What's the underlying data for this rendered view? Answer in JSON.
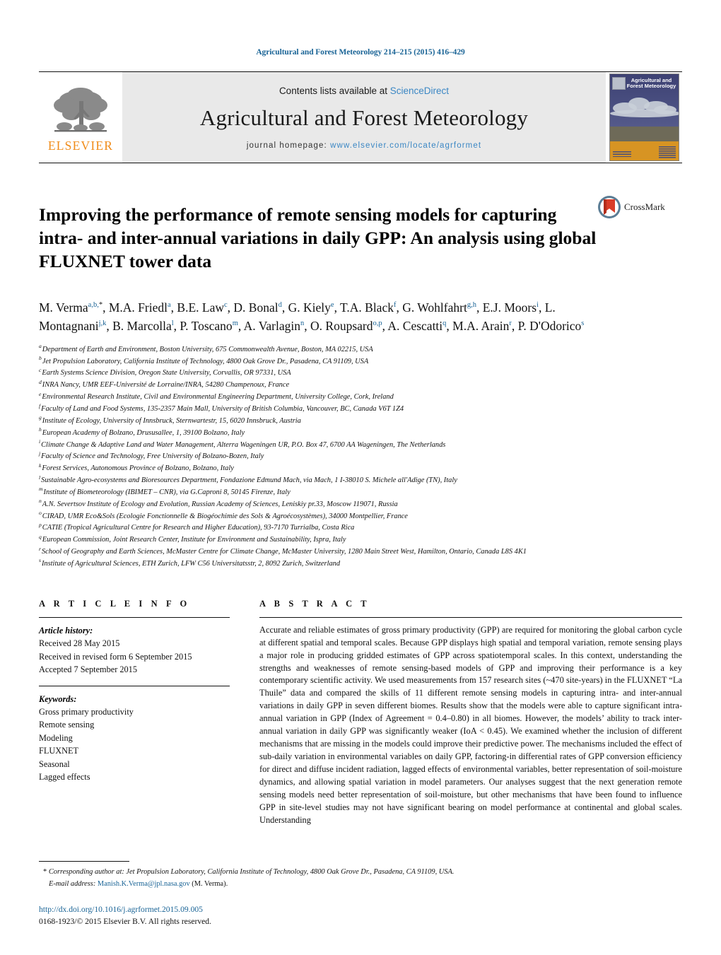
{
  "running_head": "Agricultural and Forest Meteorology 214–215 (2015) 416–429",
  "masthead": {
    "publisher_name": "ELSEVIER",
    "contents_prefix": "Contents lists available at ",
    "sciencedirect": "ScienceDirect",
    "journal_title": "Agricultural and Forest Meteorology",
    "homepage_label": "journal homepage: ",
    "homepage_url": "www.elsevier.com/locate/agrformet",
    "cover_title": "Agricultural and Forest Meteorology"
  },
  "article": {
    "title": "Improving the performance of remote sensing models for capturing intra- and inter-annual variations in daily GPP: An analysis using global FLUXNET tower data",
    "crossmark_label": "CrossMark",
    "authors_html": "M. Verma<sup class=\"sup\">a,b,</sup><sup class=\"sup star\">*</sup>, M.A. Friedl<sup class=\"sup\">a</sup>, B.E. Law<sup class=\"sup\">c</sup>, D. Bonal<sup class=\"sup\">d</sup>, G. Kiely<sup class=\"sup\">e</sup>, T.A. Black<sup class=\"sup\">f</sup>, G. Wohlfahrt<sup class=\"sup\">g,h</sup>, E.J. Moors<sup class=\"sup\">i</sup>, L. Montagnani<sup class=\"sup\">j,k</sup>, B. Marcolla<sup class=\"sup\">l</sup>, P. Toscano<sup class=\"sup\">m</sup>, A. Varlagin<sup class=\"sup\">n</sup>, O. Roupsard<sup class=\"sup\">o,p</sup>, A. Cescatti<sup class=\"sup\">q</sup>, M.A. Arain<sup class=\"sup\">r</sup>, P. D'Odorico<sup class=\"sup\">s</sup>"
  },
  "affiliations": [
    {
      "label": "a",
      "text": "Department of Earth and Environment, Boston University, 675 Commonwealth Avenue, Boston, MA 02215, USA"
    },
    {
      "label": "b",
      "text": "Jet Propulsion Laboratory, California Institute of Technology, 4800 Oak Grove Dr., Pasadena, CA 91109, USA"
    },
    {
      "label": "c",
      "text": "Earth Systems Science Division, Oregon State University, Corvallis, OR 97331, USA"
    },
    {
      "label": "d",
      "text": "INRA Nancy, UMR EEF-Université de Lorraine/INRA, 54280 Champenoux, France"
    },
    {
      "label": "e",
      "text": "Environmental Research Institute, Civil and Environmental Engineering Department, University College, Cork, Ireland"
    },
    {
      "label": "f",
      "text": "Faculty of Land and Food Systems, 135-2357 Main Mall, University of British Columbia, Vancouver, BC, Canada V6T 1Z4"
    },
    {
      "label": "g",
      "text": "Institute of Ecology, University of Innsbruck, Sternwartestr, 15, 6020 Innsbruck, Austria"
    },
    {
      "label": "h",
      "text": "European Academy of Bolzano, Drususallee, 1, 39100 Bolzano, Italy"
    },
    {
      "label": "i",
      "text": "Climate Change & Adaptive Land and Water Management, Alterra Wageningen UR, P.O. Box 47, 6700 AA Wageningen, The Netherlands"
    },
    {
      "label": "j",
      "text": "Faculty of Science and Technology, Free University of Bolzano-Bozen, Italy"
    },
    {
      "label": "k",
      "text": "Forest Services, Autonomous Province of Bolzano, Bolzano, Italy"
    },
    {
      "label": "l",
      "text": "Sustainable Agro-ecosystems and Bioresources Department, Fondazione Edmund Mach, via Mach, 1 I-38010 S. Michele all'Adige (TN), Italy"
    },
    {
      "label": "m",
      "text": "Institute of Biometeorology (IBIMET – CNR), via G.Caproni 8, 50145 Firenze, Italy"
    },
    {
      "label": "n",
      "text": "A.N. Severtsov Institute of Ecology and Evolution, Russian Academy of Sciences, Leniskiy pr.33, Moscow 119071, Russia"
    },
    {
      "label": "o",
      "text": "CIRAD, UMR Eco&Sols (Ecologie Fonctionnelle & Biogéochimie des Sols & Agroécosystèmes), 34000 Montpellier, France"
    },
    {
      "label": "p",
      "text": "CATIE (Tropical Agricultural Centre for Research and Higher Education), 93-7170 Turrialba, Costa Rica"
    },
    {
      "label": "q",
      "text": "European Commission, Joint Research Center, Institute for Environment and Sustainability, Ispra, Italy"
    },
    {
      "label": "r",
      "text": "School of Geography and Earth Sciences, McMaster Centre for Climate Change, McMaster University, 1280 Main Street West, Hamilton, Ontario, Canada L8S 4K1"
    },
    {
      "label": "s",
      "text": "Institute of Agricultural Sciences, ETH Zurich, LFW C56 Universitatsstr, 2, 8092 Zurich, Switzerland"
    }
  ],
  "article_info": {
    "heading": "A R T I C L E   I N F O",
    "history_label": "Article history:",
    "history": [
      "Received 28 May 2015",
      "Received in revised form 6 September 2015",
      "Accepted 7 September 2015"
    ],
    "keywords_label": "Keywords:",
    "keywords": [
      "Gross primary productivity",
      "Remote sensing",
      "Modeling",
      "FLUXNET",
      "Seasonal",
      "Lagged effects"
    ]
  },
  "abstract": {
    "heading": "A B S T R A C T",
    "text": "Accurate and reliable estimates of gross primary productivity (GPP) are required for monitoring the global carbon cycle at different spatial and temporal scales. Because GPP displays high spatial and temporal variation, remote sensing plays a major role in producing gridded estimates of GPP across spatiotemporal scales. In this context, understanding the strengths and weaknesses of remote sensing-based models of GPP and improving their performance is a key contemporary scientific activity. We used measurements from 157 research sites (~470 site-years) in the FLUXNET “La Thuile” data and compared the skills of 11 different remote sensing models in capturing intra- and inter-annual variations in daily GPP in seven different biomes. Results show that the models were able to capture significant intra-annual variation in GPP (Index of Agreement = 0.4–0.80) in all biomes. However, the models’ ability to track inter-annual variation in daily GPP was significantly weaker (IoA < 0.45). We examined whether the inclusion of different mechanisms that are missing in the models could improve their predictive power. The mechanisms included the effect of sub-daily variation in environmental variables on daily GPP, factoring-in differential rates of GPP conversion efficiency for direct and diffuse incident radiation, lagged effects of environmental variables, better representation of soil-moisture dynamics, and allowing spatial variation in model parameters. Our analyses suggest that the next generation remote sensing models need better representation of soil-moisture, but other mechanisms that have been found to influence GPP in site-level studies may not have significant bearing on model performance at continental and global scales. Understanding"
  },
  "footer": {
    "corresponding_star": "*",
    "corresponding_text": "Corresponding author at: Jet Propulsion Laboratory, California Institute of Technology, 4800 Oak Grove Dr., Pasadena, CA 91109, USA.",
    "email_label": "E-mail address:",
    "email": "Manish.K.Verma@jpl.nasa.gov",
    "email_suffix": "(M. Verma).",
    "doi": "http://dx.doi.org/10.1016/j.agrformet.2015.09.005",
    "copyright": "0168-1923/© 2015 Elsevier B.V. All rights reserved."
  },
  "colors": {
    "link_blue": "#1a6496",
    "sciencedirect_blue": "#3b87c4",
    "elsevier_orange": "#F08C1A",
    "masthead_gray": "#e9e9e9"
  }
}
